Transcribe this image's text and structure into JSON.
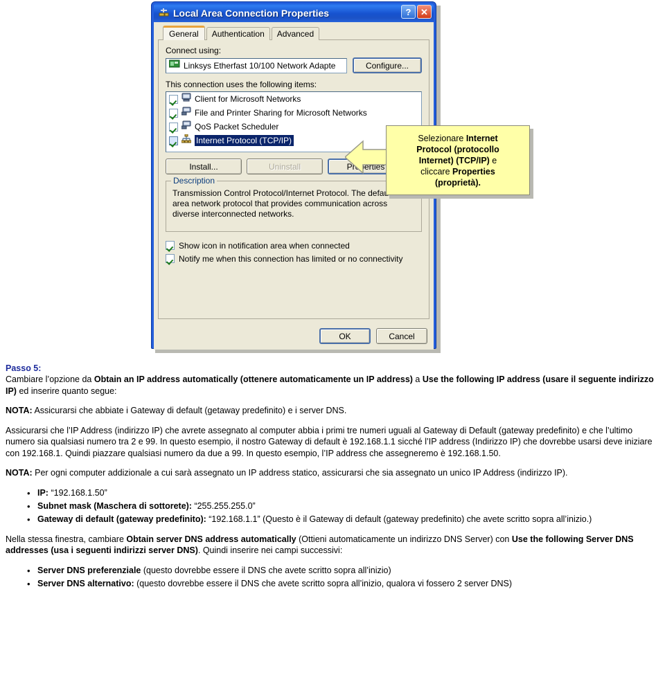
{
  "dialog": {
    "title": "Local Area Connection Properties",
    "titlebar_icon": "network-connection-icon",
    "help_button": "?",
    "close_button": "✕",
    "tabs": [
      {
        "label": "General",
        "active": true
      },
      {
        "label": "Authentication",
        "active": false
      },
      {
        "label": "Advanced",
        "active": false
      }
    ],
    "connect_using_label": "Connect using:",
    "adapter": {
      "icon": "network-adapter-icon",
      "name": "Linksys Etherfast 10/100 Network Adapte"
    },
    "configure_button": "Configure...",
    "items_label": "This connection uses the following items:",
    "items": [
      {
        "label": "Client for Microsoft Networks",
        "checked": true,
        "selected": false,
        "icon": "computer-icon"
      },
      {
        "label": "File and Printer Sharing for Microsoft Networks",
        "checked": true,
        "selected": false,
        "icon": "computer-share-icon"
      },
      {
        "label": "QoS Packet Scheduler",
        "checked": true,
        "selected": false,
        "icon": "computer-share-icon"
      },
      {
        "label": "Internet Protocol (TCP/IP)",
        "checked": true,
        "selected": true,
        "icon": "protocol-icon"
      }
    ],
    "install_button": "Install...",
    "uninstall_button": "Uninstall",
    "properties_button": "Properties",
    "description_legend": "Description",
    "description_text": "Transmission Control Protocol/Internet Protocol. The default wide area network protocol that provides communication across diverse interconnected networks.",
    "checkbox_show_icon": "Show icon in notification area when connected",
    "checkbox_show_icon_checked": true,
    "checkbox_notify": "Notify me when this connection has limited or no connectivity",
    "checkbox_notify_checked": true,
    "ok_button": "OK",
    "cancel_button": "Cancel"
  },
  "callout": {
    "arrow_icon": "left-arrow-icon",
    "line1_plain": "Selezionare ",
    "line1_bold": "Internet",
    "line2_bold": "Protocol (protocollo",
    "line3_bold_a": "Internet) (TCP/IP)",
    "line3_plain": " e",
    "line4_plain": "cliccare ",
    "line4_bold": "Properties",
    "line5_bold": "(proprietà)."
  },
  "document": {
    "step_heading": "Passo 5:",
    "step_intro_1": "Cambiare l’opzione da ",
    "step_intro_b1": "Obtain an IP address automatically (ottenere automaticamente un IP address)",
    "step_intro_2": " a ",
    "step_intro_b2": "Use the following IP address (usare il seguente indirizzo IP)",
    "step_intro_3": " ed inserire quanto segue:",
    "nota1_label": "NOTA:",
    "nota1_text": " Assicurarsi che abbiate i Gateway di default (getaway predefinito) e i server DNS.",
    "para_ip": "Assicurarsi che l’IP Address (indirizzo IP) che avrete assegnato al computer abbia i primi tre numeri uguali al Gateway di Default (gateway predefinito) e che l’ultimo numero sia qualsiasi numero tra 2 e 99. In questo esempio, il nostro Gateway di default è 192.168.1.1 sicché l’IP address (Indirizzo IP) che dovrebbe usarsi deve iniziare con 192.168.1. Quindi piazzare qualsiasi numero da due a 99. In questo esempio, l’IP address che assegneremo è 192.168.1.50.",
    "nota2_label": "NOTA:",
    "nota2_text": " Per ogni computer addizionale a cui sarà assegnato un IP address statico, assicurarsi che sia assegnato un unico IP Address (indirizzo IP).",
    "bullets_ip": [
      {
        "bold": "IP:",
        "plain": " “192.168.1.50”"
      },
      {
        "bold": "Subnet mask (Maschera di sottorete):",
        "plain": " “255.255.255.0”"
      },
      {
        "bold": "Gateway di default (gateway predefinito):",
        "plain": " “192.168.1.1” (Questo è il Gateway di default (gateway predefinito) che avete scritto sopra all’inizio.)"
      }
    ],
    "dns_para_1": "Nella stessa finestra, cambiare ",
    "dns_para_b1": "Obtain server DNS address automatically",
    "dns_para_2": " (Ottieni automaticamente un indirizzo DNS Server) con ",
    "dns_para_b2": "Use the following Server DNS addresses (usa i seguenti indirizzi server DNS)",
    "dns_para_3": ". Quindi inserire nei campi successivi:",
    "bullets_dns": [
      {
        "bold": "Server DNS preferenziale",
        "plain": " (questo dovrebbe essere il DNS che avete scritto sopra all’inizio)"
      },
      {
        "bold": "Server DNS alternativo:",
        "plain": " (questo dovrebbe essere il DNS che avete scritto sopra all’inizio, qualora vi fossero 2 server DNS)"
      }
    ]
  },
  "colors": {
    "titlebar_blue": "#1b52c6",
    "dialog_face": "#ece9d8",
    "selection_blue": "#0a246a",
    "callout_yellow": "#ffffa8",
    "heading_blue": "#1e2c9c",
    "tab_accent_orange": "#e8a33d"
  }
}
